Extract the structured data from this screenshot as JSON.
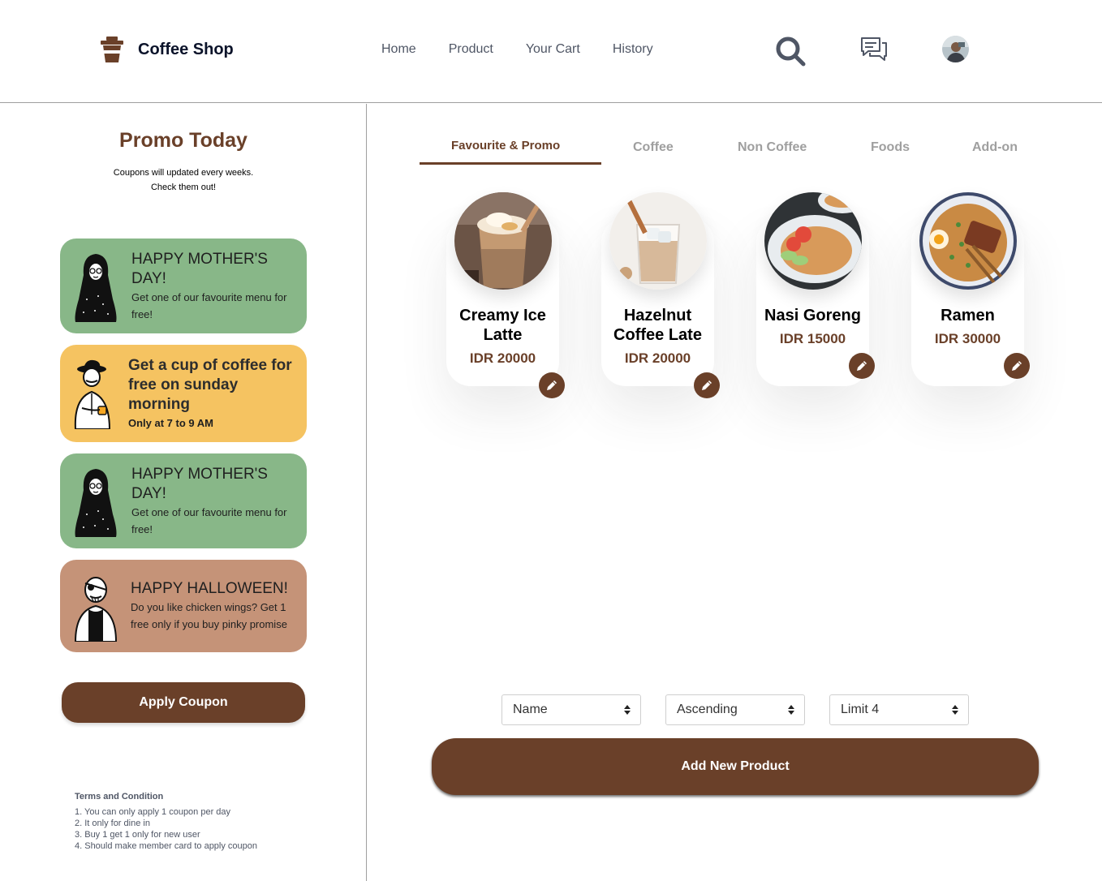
{
  "header": {
    "logo_icon": "coffee-cup-icon",
    "brand": "Coffee Shop",
    "nav": [
      {
        "label": "Home"
      },
      {
        "label": "Product"
      },
      {
        "label": "Your Cart"
      },
      {
        "label": "History"
      }
    ],
    "icons": [
      "search-icon",
      "chat-icon",
      "avatar"
    ]
  },
  "sidebar": {
    "title": "Promo Today",
    "subtitle_line1": "Coupons will updated every weeks.",
    "subtitle_line2": "Check them out!",
    "coupons": [
      {
        "title": "HAPPY MOTHER'S DAY!",
        "desc": "Get one of our favourite menu for free!",
        "color": "#88b788",
        "figure": "mother-illustration-icon"
      },
      {
        "title": "Get a cup of coffee for free on sunday morning",
        "desc": "Only at 7 to 9 AM",
        "color": "#f5c361",
        "figure": "man-with-coffee-illustration-icon"
      },
      {
        "title": "HAPPY MOTHER'S DAY!",
        "desc": "Get one of our favourite menu for free!",
        "color": "#88b788",
        "figure": "mother-illustration-icon"
      },
      {
        "title": "HAPPY HALLOWEEN!",
        "desc": "Do you like chicken wings? Get 1 free only if you buy pinky promise",
        "color": "#c59378",
        "figure": "pirate-illustration-icon"
      }
    ],
    "apply_label": "Apply Coupon",
    "terms": {
      "title": "Terms and Condition",
      "items": [
        "1. You can only apply 1 coupon per day",
        "2. It only for dine in",
        "3. Buy 1 get 1 only for new user",
        "4. Should make member card to apply coupon"
      ]
    }
  },
  "main": {
    "tabs": [
      {
        "label": "Favourite & Promo",
        "active": true
      },
      {
        "label": "Coffee"
      },
      {
        "label": "Non Coffee"
      },
      {
        "label": "Foods"
      },
      {
        "label": "Add-on"
      }
    ],
    "products": [
      {
        "name": "Creamy Ice Latte",
        "price": "IDR 20000"
      },
      {
        "name": "Hazelnut Coffee Late",
        "price": "IDR 20000"
      },
      {
        "name": "Nasi Goreng",
        "price": "IDR 15000"
      },
      {
        "name": "Ramen",
        "price": "IDR 30000"
      }
    ],
    "filters": {
      "sort_by": "Name",
      "order": "Ascending",
      "limit": "Limit 4"
    },
    "add_label": "Add New Product"
  },
  "colors": {
    "brand_brown": "#6a4029",
    "green": "#88b788",
    "yellow": "#f5c361",
    "brown_light": "#c59378"
  }
}
